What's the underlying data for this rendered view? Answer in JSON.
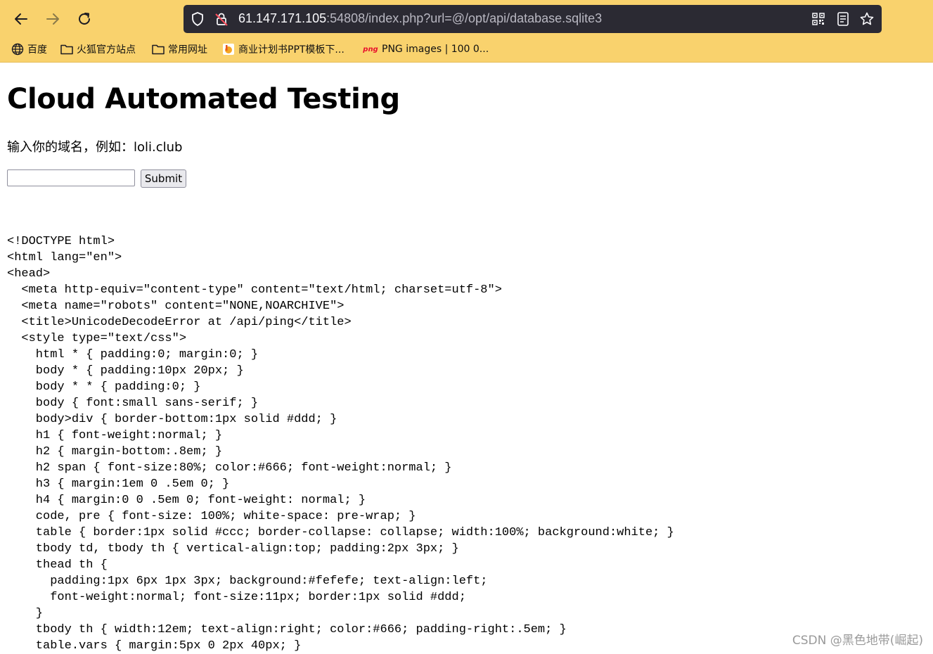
{
  "browser": {
    "url_host": "61.147.171.105",
    "url_rest": ":54808/index.php?url=@/opt/api/database.sqlite3",
    "bookmarks": [
      {
        "label": "百度",
        "icon": "globe-icon"
      },
      {
        "label": "火狐官方站点",
        "icon": "folder-icon"
      },
      {
        "label": "常用网址",
        "icon": "folder-icon"
      },
      {
        "label": "商业计划书PPT模板下...",
        "icon": "ppt-site-icon"
      },
      {
        "label": "PNG images | 100 0...",
        "icon": "png-site-icon"
      }
    ],
    "png_icon_text": "png"
  },
  "page": {
    "title": "Cloud Automated Testing",
    "prompt": "输入你的域名，例如：loli.club",
    "input_value": "",
    "submit_label": "Submit",
    "source_lines": [
      "<!DOCTYPE html>",
      "<html lang=\"en\">",
      "<head>",
      "  <meta http-equiv=\"content-type\" content=\"text/html; charset=utf-8\">",
      "  <meta name=\"robots\" content=\"NONE,NOARCHIVE\">",
      "  <title>UnicodeDecodeError at /api/ping</title>",
      "  <style type=\"text/css\">",
      "    html * { padding:0; margin:0; }",
      "    body * { padding:10px 20px; }",
      "    body * * { padding:0; }",
      "    body { font:small sans-serif; }",
      "    body>div { border-bottom:1px solid #ddd; }",
      "    h1 { font-weight:normal; }",
      "    h2 { margin-bottom:.8em; }",
      "    h2 span { font-size:80%; color:#666; font-weight:normal; }",
      "    h3 { margin:1em 0 .5em 0; }",
      "    h4 { margin:0 0 .5em 0; font-weight: normal; }",
      "    code, pre { font-size: 100%; white-space: pre-wrap; }",
      "    table { border:1px solid #ccc; border-collapse: collapse; width:100%; background:white; }",
      "    tbody td, tbody th { vertical-align:top; padding:2px 3px; }",
      "    thead th {",
      "      padding:1px 6px 1px 3px; background:#fefefe; text-align:left;",
      "      font-weight:normal; font-size:11px; border:1px solid #ddd;",
      "    }",
      "    tbody th { width:12em; text-align:right; color:#666; padding-right:.5em; }",
      "    table.vars { margin:5px 0 2px 40px; }"
    ]
  },
  "watermark": "CSDN @黑色地带(崛起)",
  "colors": {
    "chrome_bg": "#f9d26d",
    "urlbar_bg": "#2b2a33"
  }
}
